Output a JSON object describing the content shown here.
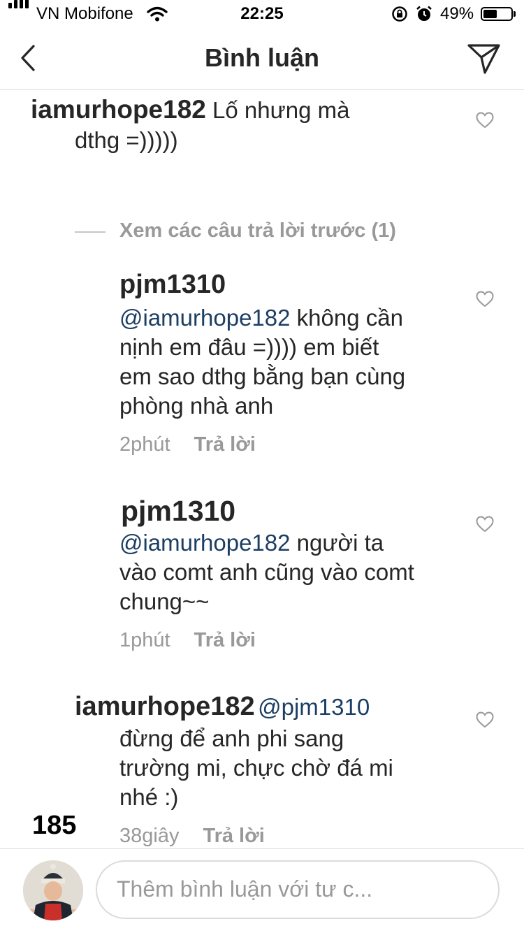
{
  "status_bar": {
    "carrier": "VN Mobifone",
    "time": "22:25",
    "battery_percent": "49%",
    "battery_level": 0.49
  },
  "header": {
    "title": "Bình luận"
  },
  "comments": [
    {
      "username": "iamurhope182",
      "text_line1": "Lố nhưng mà",
      "text_line2": "dthg =)))))"
    },
    {
      "username": "pjm1310",
      "mention": "@iamurhope182",
      "text_line1": "không cần",
      "text_line2": "nịnh em đâu =)))) em biết",
      "text_line3": "em sao dthg bằng bạn cùng",
      "text_line4": "phòng nhà anh",
      "time": "2phút",
      "reply_label": "Trả lời"
    },
    {
      "username": "pjm1310",
      "mention": "@iamurhope182",
      "text_line1": "người ta",
      "text_line2": "vào comt anh cũng vào comt",
      "text_line3": "chung~~",
      "time": "1phút",
      "reply_label": "Trả lời"
    },
    {
      "username": "iamurhope182",
      "mention": "@pjm1310",
      "text_line1": "đừng để anh phi sang",
      "text_line2": "trường mi, chực chờ đá mi",
      "text_line3": "nhé :)",
      "time": "38giây",
      "reply_label": "Trả lời"
    }
  ],
  "view_previous_replies": "Xem các câu trả lời trước (1)",
  "overlay_counter": "185",
  "comment_input": {
    "placeholder": "Thêm bình luận với tư c..."
  },
  "icons": {
    "back": "chevron-left-icon",
    "send": "paper-plane-icon",
    "like": "heart-outline-icon",
    "wifi": "wifi-icon",
    "lock": "rotation-lock-icon",
    "alarm": "alarm-icon"
  }
}
